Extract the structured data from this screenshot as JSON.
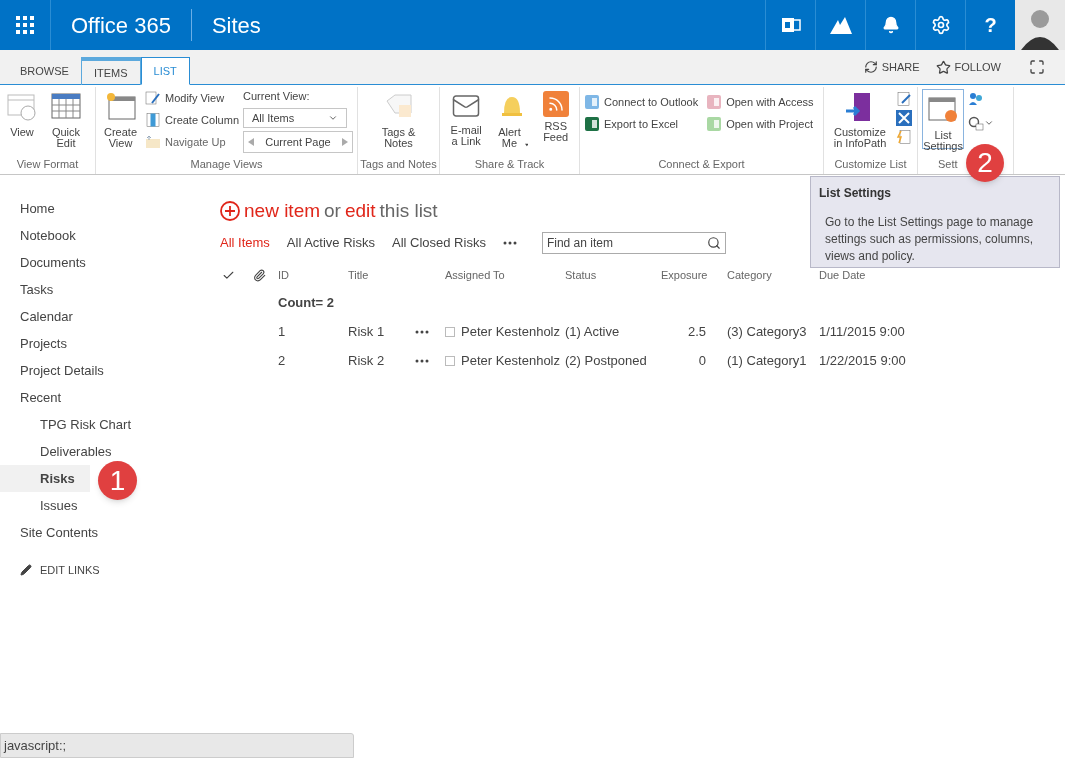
{
  "top_bar": {
    "app_title": "Office 365",
    "site_title": "Sites",
    "help": "?"
  },
  "ribbon": {
    "tabs": [
      {
        "label": "BROWSE",
        "selected": false
      },
      {
        "label": "ITEMS",
        "selected": false
      },
      {
        "label": "LIST",
        "selected": true
      }
    ],
    "actions": [
      "SHARE",
      "FOLLOW"
    ],
    "groups": [
      {
        "label": "View Format",
        "commands": [
          {
            "label": "View"
          },
          {
            "label": "Quick Edit"
          }
        ]
      },
      {
        "label": "Manage Views",
        "commands": [
          {
            "label": "Create View"
          },
          {
            "label": "Modify View"
          },
          {
            "label": "Create Column"
          },
          {
            "label": "Navigate Up"
          }
        ],
        "current_view_label": "Current View:",
        "current_view": "All Items",
        "pager": "Current Page"
      },
      {
        "label": "Tags and Notes",
        "commands": [
          {
            "label": "Tags & Notes"
          }
        ]
      },
      {
        "label": "Share & Track",
        "commands": [
          {
            "label": "E-mail a Link"
          },
          {
            "label": "Alert Me"
          },
          {
            "label": "RSS Feed"
          }
        ]
      },
      {
        "label": "Connect & Export",
        "commands": [
          {
            "label": "Connect to Outlook"
          },
          {
            "label": "Export to Excel"
          },
          {
            "label": "Open with Access"
          },
          {
            "label": "Open with Project"
          }
        ]
      },
      {
        "label": "Customize List",
        "commands": [
          {
            "label": "Customize in InfoPath"
          }
        ]
      },
      {
        "label": "Sett",
        "commands": [
          {
            "label": "List Settings"
          }
        ]
      }
    ]
  },
  "tooltip": {
    "title": "List Settings",
    "text": "Go to the List Settings page to manage settings such as permissions, columns, views and policy."
  },
  "nav": {
    "items": [
      {
        "label": "Home",
        "selected": false
      },
      {
        "label": "Notebook",
        "selected": false
      },
      {
        "label": "Documents",
        "selected": false
      },
      {
        "label": "Tasks",
        "selected": false
      },
      {
        "label": "Calendar",
        "selected": false
      },
      {
        "label": "Projects",
        "selected": false
      },
      {
        "label": "Project Details",
        "selected": false
      },
      {
        "label": "Recent",
        "selected": false,
        "children": [
          {
            "label": "TPG Risk Chart",
            "selected": false
          },
          {
            "label": "Deliverables",
            "selected": false
          },
          {
            "label": "Risks",
            "selected": true
          },
          {
            "label": "Issues",
            "selected": false
          }
        ]
      },
      {
        "label": "Site Contents",
        "selected": false
      }
    ],
    "edit_links": "EDIT LINKS"
  },
  "callouts": [
    "1",
    "2"
  ],
  "list": {
    "new_item": "new item",
    "or": "or",
    "edit": "edit",
    "this_list": "this list",
    "views": [
      {
        "label": "All Items",
        "selected": true
      },
      {
        "label": "All Active Risks",
        "selected": false
      },
      {
        "label": "All Closed Risks",
        "selected": false
      }
    ],
    "search": {
      "placeholder": "Find an item"
    },
    "columns": [
      "ID",
      "Title",
      "Assigned To",
      "Status",
      "Exposure",
      "Category",
      "Due Date"
    ],
    "group": "Count= 2",
    "rows": [
      {
        "id": "1",
        "title": "Risk 1",
        "assigned_to": "Peter Kestenholz",
        "status": "(1) Active",
        "exposure": "2.5",
        "category": "(3) Category3",
        "due_date": "1/11/2015 9:00"
      },
      {
        "id": "2",
        "title": "Risk 2",
        "assigned_to": "Peter Kestenholz",
        "status": "(2) Postponed",
        "exposure": "0",
        "category": "(1) Category1",
        "due_date": "1/22/2015 9:00"
      }
    ]
  },
  "status_bar": "javascript:;"
}
